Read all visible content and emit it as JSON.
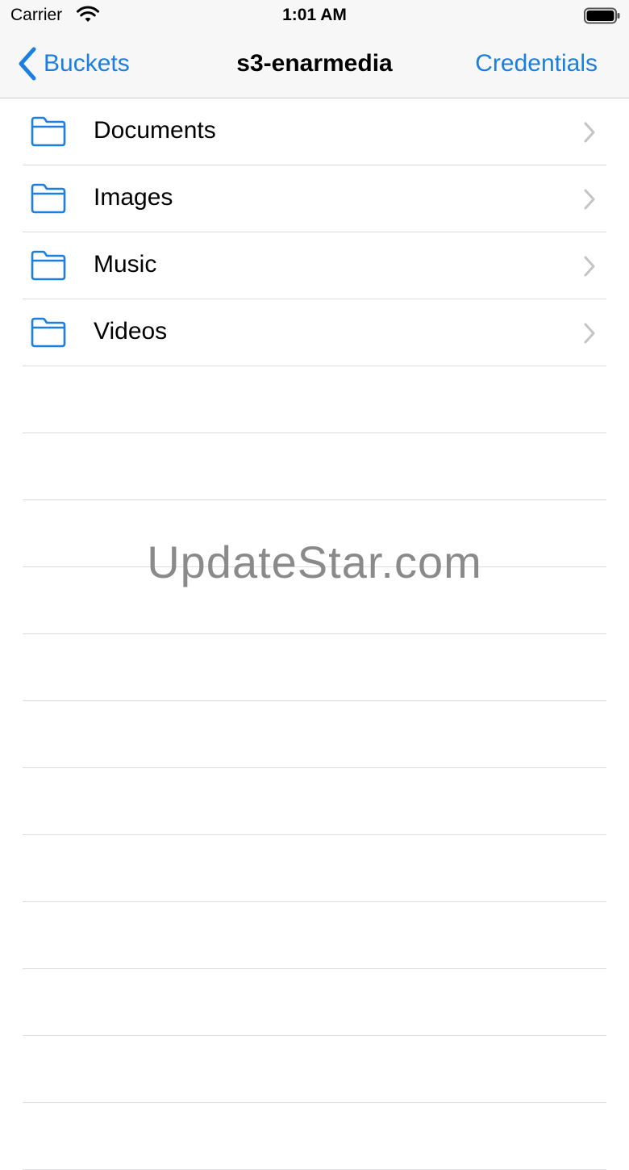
{
  "status_bar": {
    "carrier": "Carrier",
    "time": "1:01 AM"
  },
  "nav": {
    "back_label": "Buckets",
    "title": "s3-enarmedia",
    "right_label": "Credentials"
  },
  "folders": [
    {
      "label": "Documents",
      "icon": "folder-icon"
    },
    {
      "label": "Images",
      "icon": "folder-icon"
    },
    {
      "label": "Music",
      "icon": "folder-icon"
    },
    {
      "label": "Videos",
      "icon": "folder-icon"
    }
  ],
  "watermark": "UpdateStar.com",
  "colors": {
    "accent": "#1a7fe0",
    "separator": "#dcdcdf",
    "bar_background": "#f7f7f7"
  }
}
